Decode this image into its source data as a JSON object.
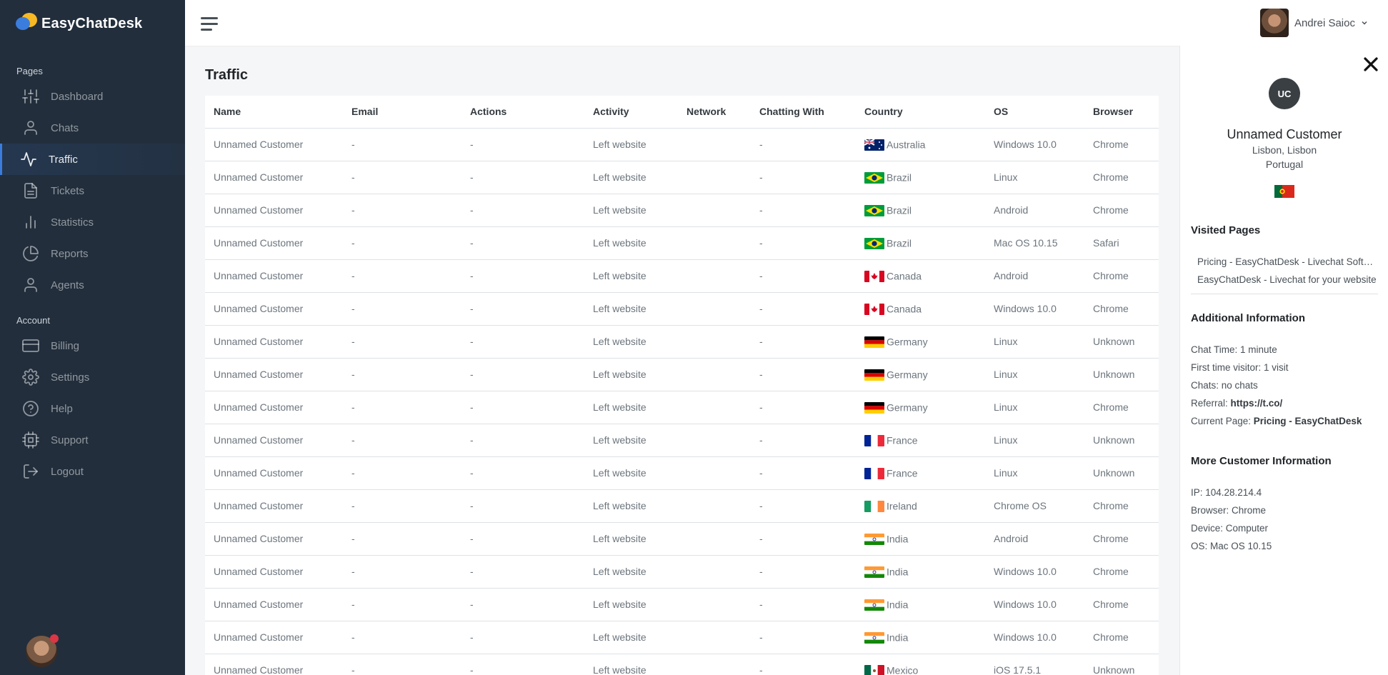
{
  "brand": {
    "name": "EasyChatDesk"
  },
  "sidebar": {
    "pages_header": "Pages",
    "account_header": "Account",
    "pages": [
      {
        "label": "Dashboard",
        "icon": "sliders-icon"
      },
      {
        "label": "Chats",
        "icon": "user-icon"
      },
      {
        "label": "Traffic",
        "icon": "activity-icon"
      },
      {
        "label": "Tickets",
        "icon": "file-text-icon"
      },
      {
        "label": "Statistics",
        "icon": "bar-chart-icon"
      },
      {
        "label": "Reports",
        "icon": "pie-chart-icon"
      },
      {
        "label": "Agents",
        "icon": "user-icon"
      }
    ],
    "account": [
      {
        "label": "Billing",
        "icon": "credit-card-icon"
      },
      {
        "label": "Settings",
        "icon": "settings-icon"
      },
      {
        "label": "Help",
        "icon": "help-circle-icon"
      },
      {
        "label": "Support",
        "icon": "cpu-icon"
      },
      {
        "label": "Logout",
        "icon": "log-out-icon"
      }
    ]
  },
  "topbar": {
    "user_name": "Andrei Saioc"
  },
  "main": {
    "title": "Traffic",
    "columns": [
      "Name",
      "Email",
      "Actions",
      "Activity",
      "Network",
      "Chatting With",
      "Country",
      "OS",
      "Browser"
    ],
    "rows": [
      {
        "name": "Unnamed Customer",
        "email": "-",
        "actions": "-",
        "activity": "Left website",
        "network": "",
        "chatting": "-",
        "country": "Australia",
        "os": "Windows 10.0",
        "browser": "Chrome"
      },
      {
        "name": "Unnamed Customer",
        "email": "-",
        "actions": "-",
        "activity": "Left website",
        "network": "",
        "chatting": "-",
        "country": "Brazil",
        "os": "Linux",
        "browser": "Chrome"
      },
      {
        "name": "Unnamed Customer",
        "email": "-",
        "actions": "-",
        "activity": "Left website",
        "network": "",
        "chatting": "-",
        "country": "Brazil",
        "os": "Android",
        "browser": "Chrome"
      },
      {
        "name": "Unnamed Customer",
        "email": "-",
        "actions": "-",
        "activity": "Left website",
        "network": "",
        "chatting": "-",
        "country": "Brazil",
        "os": "Mac OS 10.15",
        "browser": "Safari"
      },
      {
        "name": "Unnamed Customer",
        "email": "-",
        "actions": "-",
        "activity": "Left website",
        "network": "",
        "chatting": "-",
        "country": "Canada",
        "os": "Android",
        "browser": "Chrome"
      },
      {
        "name": "Unnamed Customer",
        "email": "-",
        "actions": "-",
        "activity": "Left website",
        "network": "",
        "chatting": "-",
        "country": "Canada",
        "os": "Windows 10.0",
        "browser": "Chrome"
      },
      {
        "name": "Unnamed Customer",
        "email": "-",
        "actions": "-",
        "activity": "Left website",
        "network": "",
        "chatting": "-",
        "country": "Germany",
        "os": "Linux",
        "browser": "Unknown"
      },
      {
        "name": "Unnamed Customer",
        "email": "-",
        "actions": "-",
        "activity": "Left website",
        "network": "",
        "chatting": "-",
        "country": "Germany",
        "os": "Linux",
        "browser": "Unknown"
      },
      {
        "name": "Unnamed Customer",
        "email": "-",
        "actions": "-",
        "activity": "Left website",
        "network": "",
        "chatting": "-",
        "country": "Germany",
        "os": "Linux",
        "browser": "Chrome"
      },
      {
        "name": "Unnamed Customer",
        "email": "-",
        "actions": "-",
        "activity": "Left website",
        "network": "",
        "chatting": "-",
        "country": "France",
        "os": "Linux",
        "browser": "Unknown"
      },
      {
        "name": "Unnamed Customer",
        "email": "-",
        "actions": "-",
        "activity": "Left website",
        "network": "",
        "chatting": "-",
        "country": "France",
        "os": "Linux",
        "browser": "Unknown"
      },
      {
        "name": "Unnamed Customer",
        "email": "-",
        "actions": "-",
        "activity": "Left website",
        "network": "",
        "chatting": "-",
        "country": "Ireland",
        "os": "Chrome OS",
        "browser": "Chrome"
      },
      {
        "name": "Unnamed Customer",
        "email": "-",
        "actions": "-",
        "activity": "Left website",
        "network": "",
        "chatting": "-",
        "country": "India",
        "os": "Android",
        "browser": "Chrome"
      },
      {
        "name": "Unnamed Customer",
        "email": "-",
        "actions": "-",
        "activity": "Left website",
        "network": "",
        "chatting": "-",
        "country": "India",
        "os": "Windows 10.0",
        "browser": "Chrome"
      },
      {
        "name": "Unnamed Customer",
        "email": "-",
        "actions": "-",
        "activity": "Left website",
        "network": "",
        "chatting": "-",
        "country": "India",
        "os": "Windows 10.0",
        "browser": "Chrome"
      },
      {
        "name": "Unnamed Customer",
        "email": "-",
        "actions": "-",
        "activity": "Left website",
        "network": "",
        "chatting": "-",
        "country": "India",
        "os": "Windows 10.0",
        "browser": "Chrome"
      },
      {
        "name": "Unnamed Customer",
        "email": "-",
        "actions": "-",
        "activity": "Left website",
        "network": "",
        "chatting": "-",
        "country": "Mexico",
        "os": "iOS 17.5.1",
        "browser": "Unknown"
      }
    ]
  },
  "panel": {
    "initials": "UC",
    "name": "Unnamed Customer",
    "city": "Lisbon, Lisbon",
    "country": "Portugal",
    "visited_title": "Visited Pages",
    "visited": [
      "Pricing - EasyChatDesk - Livechat Software",
      "EasyChatDesk - Livechat for your website"
    ],
    "additional_title": "Additional Information",
    "chat_time": "Chat Time: 1 minute",
    "first_visit": "First time visitor: 1 visit",
    "chats": "Chats: no chats",
    "referral_label": "Referral: ",
    "referral_value": "https://t.co/",
    "current_label": "Current Page: ",
    "current_value": "Pricing - EasyChatDesk",
    "more_title": "More Customer Information",
    "ip": "IP: 104.28.214.4",
    "browser": "Browser: Chrome",
    "device": "Device: Computer",
    "os": "OS: Mac OS 10.15"
  },
  "colors": {
    "sidebar_bg": "#222e3c",
    "accent": "#3b7ddd",
    "page_bg": "#f5f6f8",
    "notification": "#dc3545"
  }
}
